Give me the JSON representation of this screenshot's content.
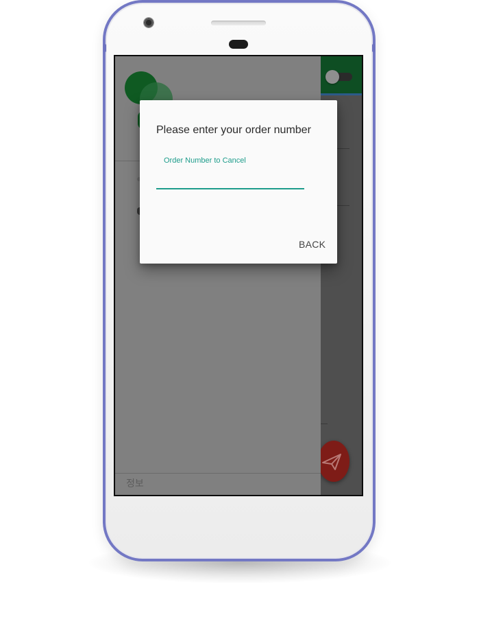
{
  "dialog": {
    "title": "Please enter your order number",
    "input_label": "Order Number to Cancel",
    "input_value": "",
    "back_label": "BACK"
  },
  "drawer": {
    "footer_label": "정보"
  },
  "colors": {
    "accent": "#1d9c8b",
    "app_bar": "#0e4e23",
    "fab": "#7e1c17",
    "phone_frame": "#7378c4"
  },
  "icons": {
    "fab": "send-icon",
    "toggle": "theme-toggle"
  }
}
